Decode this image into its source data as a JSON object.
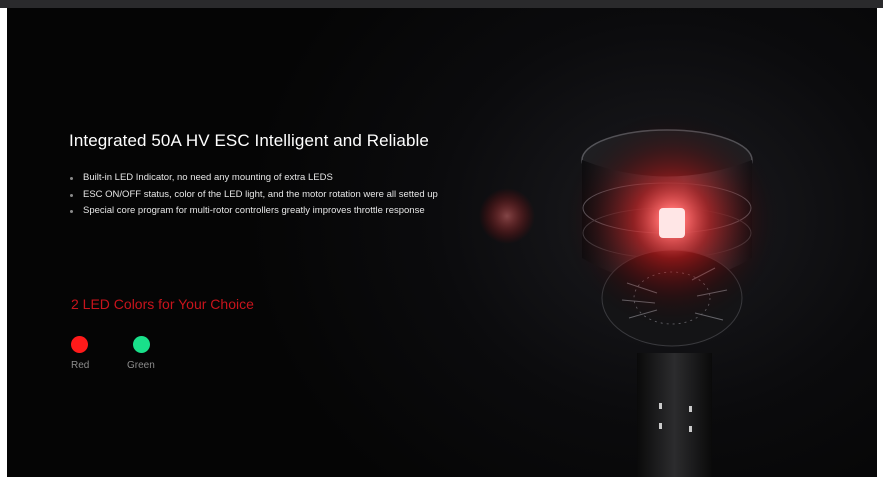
{
  "section": {
    "title": "Integrated 50A HV ESC Intelligent and Reliable",
    "features": [
      "Built-in LED Indicator, no need any mounting of extra LEDS",
      "ESC ON/OFF status, color of the LED light, and the motor rotation were all setted up",
      "Special core program for multi-rotor controllers greatly improves throttle response"
    ],
    "colors_heading": "2 LED Colors for Your Choice",
    "led_colors": [
      {
        "label": "Red",
        "color": "#ff1a1a"
      },
      {
        "label": "Green",
        "color": "#19e08a"
      }
    ]
  },
  "theme": {
    "accent": "#c8141c",
    "background": "#000000"
  },
  "image": {
    "subject": "motor-with-red-led-glow"
  }
}
